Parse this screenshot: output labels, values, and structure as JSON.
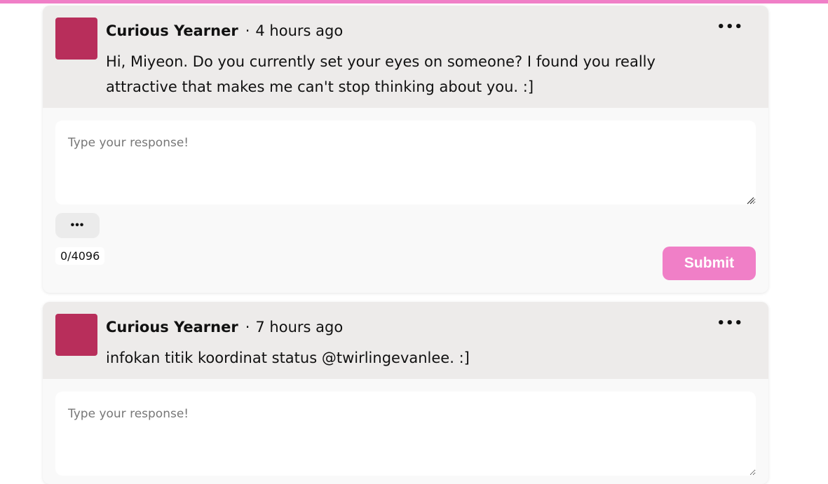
{
  "accent_color": "#f07fc7",
  "avatar_color": "#b82e5b",
  "questions": [
    {
      "author": "Curious Yearner",
      "separator": "·",
      "time": "4 hours ago",
      "text": "Hi, Miyeon. Do you currently set your eyes on someone? I found you really attractive that makes me can't stop thinking about you. :]",
      "more_icon": "more-horizontal-icon",
      "response_placeholder": "Type your response!",
      "options_label": "•••",
      "counter": "0/4096",
      "submit_label": "Submit"
    },
    {
      "author": "Curious Yearner",
      "separator": "·",
      "time": "7 hours ago",
      "text": "infokan titik koordinat status @twirlingevanlee. :]",
      "more_icon": "more-horizontal-icon",
      "response_placeholder": "Type your response!"
    }
  ]
}
